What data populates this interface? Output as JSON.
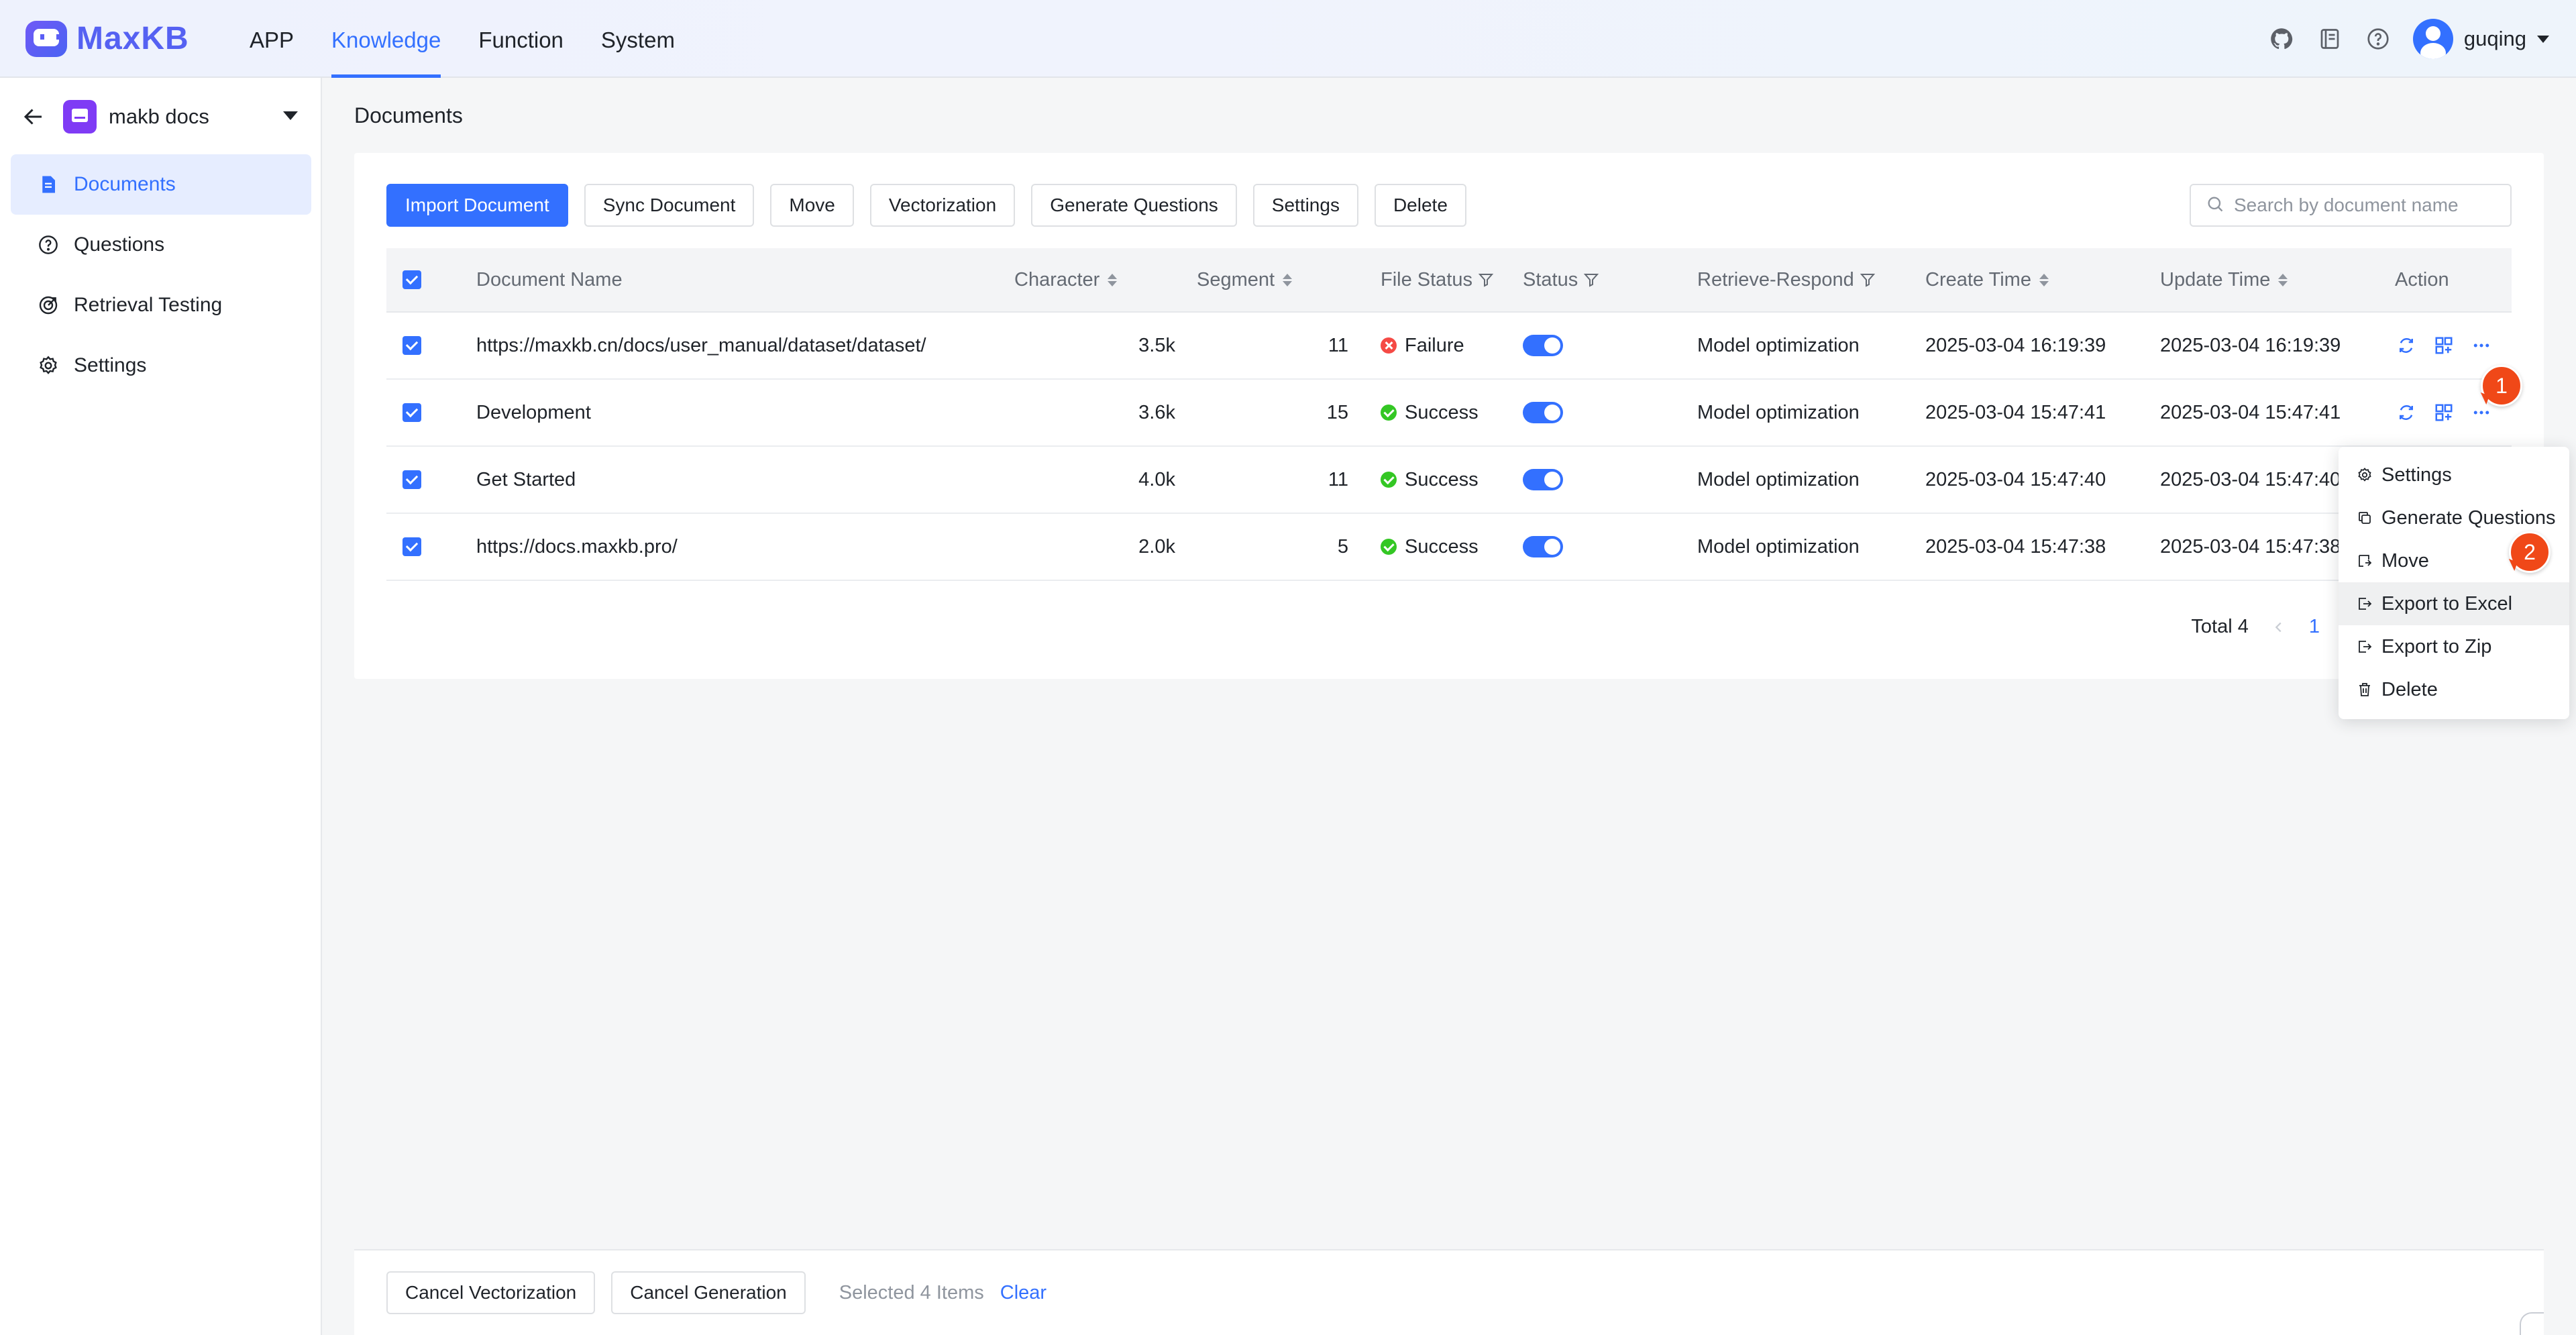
{
  "app": {
    "logo_text": "MaxKB",
    "accent": "#3370ff"
  },
  "nav": {
    "items": [
      "APP",
      "Knowledge",
      "Function",
      "System"
    ],
    "active": "Knowledge"
  },
  "user": {
    "name": "guqing"
  },
  "sidebar": {
    "kb_name": "makb docs",
    "items": [
      {
        "label": "Documents",
        "icon": "document-icon",
        "active": true
      },
      {
        "label": "Questions",
        "icon": "question-circle-icon"
      },
      {
        "label": "Retrieval Testing",
        "icon": "target-icon"
      },
      {
        "label": "Settings",
        "icon": "gear-icon"
      }
    ]
  },
  "page": {
    "title": "Documents"
  },
  "toolbar": {
    "buttons": [
      "Import Document",
      "Sync Document",
      "Move",
      "Vectorization",
      "Generate Questions",
      "Settings",
      "Delete"
    ],
    "search_placeholder": "Search by document name"
  },
  "table": {
    "columns": [
      "Document Name",
      "Character",
      "Segment",
      "File Status",
      "Status",
      "Retrieve-Respond",
      "Create Time",
      "Update Time",
      "Action"
    ],
    "rows": [
      {
        "name": "https://maxkb.cn/docs/user_manual/dataset/dataset/",
        "character": "3.5k",
        "segment": "11",
        "file_status": "Failure",
        "status_on": true,
        "retrieve_respond": "Model optimization",
        "create_time": "2025-03-04 16:19:39",
        "update_time": "2025-03-04 16:19:39"
      },
      {
        "name": "Development",
        "character": "3.6k",
        "segment": "15",
        "file_status": "Success",
        "status_on": true,
        "retrieve_respond": "Model optimization",
        "create_time": "2025-03-04 15:47:41",
        "update_time": "2025-03-04 15:47:41"
      },
      {
        "name": "Get Started",
        "character": "4.0k",
        "segment": "11",
        "file_status": "Success",
        "status_on": true,
        "retrieve_respond": "Model optimization",
        "create_time": "2025-03-04 15:47:40",
        "update_time": "2025-03-04 15:47:40"
      },
      {
        "name": "https://docs.maxkb.pro/",
        "character": "2.0k",
        "segment": "5",
        "file_status": "Success",
        "status_on": true,
        "retrieve_respond": "Model optimization",
        "create_time": "2025-03-04 15:47:38",
        "update_time": "2025-03-04 15:47:38"
      }
    ]
  },
  "pagination": {
    "total_label": "Total 4",
    "current_page": "1"
  },
  "dropdown": {
    "items": [
      {
        "label": "Settings",
        "icon": "gear-icon"
      },
      {
        "label": "Generate Questions",
        "icon": "copy-icon"
      },
      {
        "label": "Move",
        "icon": "move-icon"
      },
      {
        "label": "Export to Excel",
        "icon": "export-icon",
        "hover": true
      },
      {
        "label": "Export to Zip",
        "icon": "export-icon"
      },
      {
        "label": "Delete",
        "icon": "trash-icon"
      }
    ]
  },
  "badges": [
    "1",
    "2"
  ],
  "bottom_bar": {
    "cancel_vectorization": "Cancel Vectorization",
    "cancel_generation": "Cancel Generation",
    "selected_text": "Selected 4 Items",
    "clear_label": "Clear"
  }
}
